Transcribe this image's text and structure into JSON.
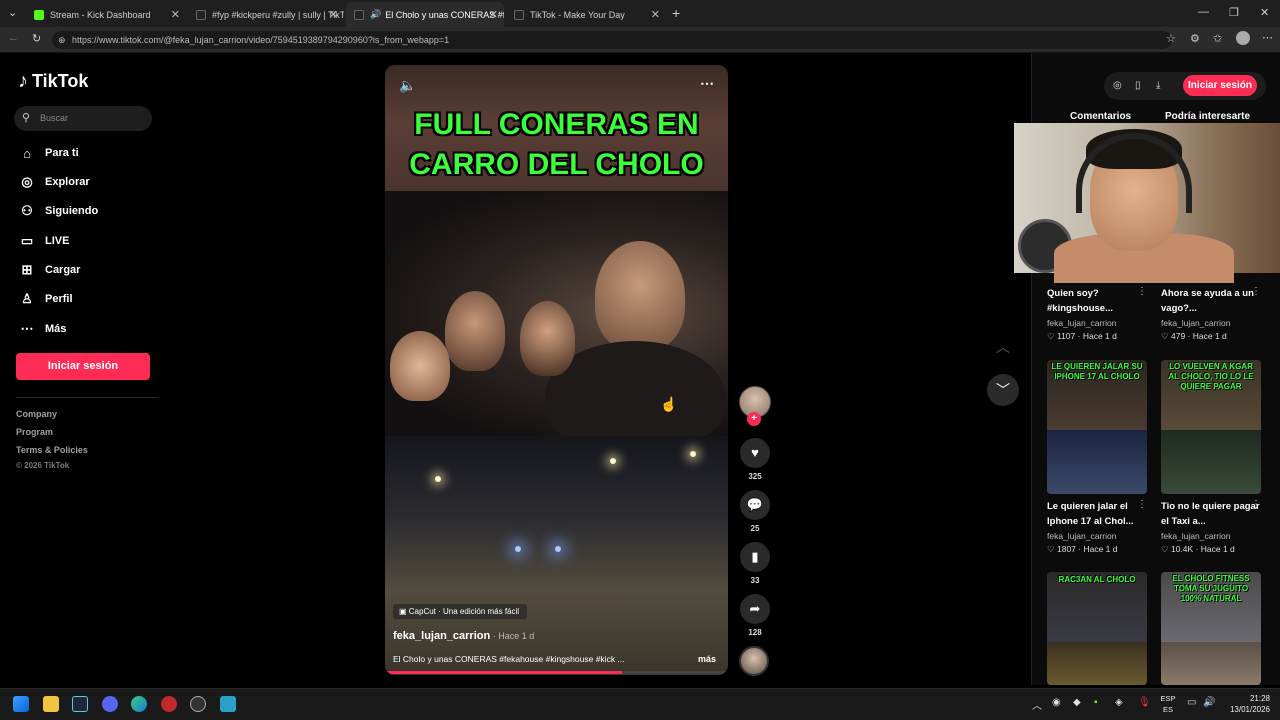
{
  "browser": {
    "tabs": [
      {
        "title": "Stream - Kick Dashboard",
        "color": "#53fc18"
      },
      {
        "title": "#fyp #kickperu #zully | sully | TikTo",
        "color": "#ffffff"
      },
      {
        "title": "El Cholo y unas CONERAS #fe",
        "color": "#ffffff"
      },
      {
        "title": "TikTok - Make Your Day",
        "color": "#ffffff"
      }
    ],
    "url": "https://www.tiktok.com/@feka_lujan_carrion/video/7594519389794290960?is_from_webapp=1"
  },
  "sidebar": {
    "logo": "TikTok",
    "search_placeholder": "Buscar",
    "nav": [
      {
        "label": "Para ti",
        "icon": "home-icon"
      },
      {
        "label": "Explorar",
        "icon": "compass-icon"
      },
      {
        "label": "Siguiendo",
        "icon": "following-icon"
      },
      {
        "label": "LIVE",
        "icon": "live-icon"
      },
      {
        "label": "Cargar",
        "icon": "upload-icon"
      },
      {
        "label": "Perfil",
        "icon": "profile-icon"
      },
      {
        "label": "Más",
        "icon": "more-icon"
      }
    ],
    "login_label": "Iniciar sesión",
    "footer": [
      "Company",
      "Program",
      "Terms & Policies"
    ],
    "copyright": "© 2026 TikTok"
  },
  "video": {
    "title_line1": "FULL CONERAS EN",
    "title_line2": "CARRO DEL CHOLO",
    "capcut": "CapCut · Una edición más fácil",
    "author": "feka_lujan_carrion",
    "time": " · Hace 1 d",
    "caption": "El Cholo y unas CONERAS #fekahouse #kingshouse #kick ...",
    "more": "más",
    "progress": 0.69
  },
  "actions": {
    "likes": "325",
    "comments": "25",
    "saves": "33",
    "shares": "128"
  },
  "right_panel": {
    "login_label": "Iniciar sesión",
    "tabs": [
      "Comentarios",
      "Podría interesarte"
    ],
    "cards": [
      {
        "title": "Quien soy? #kingshouse...",
        "author": "feka_lujan_carrion",
        "likes": "1107",
        "time": "Hace 1 d"
      },
      {
        "title": "Ahora se ayuda a un vago?...",
        "author": "feka_lujan_carrion",
        "likes": "479",
        "time": "Hace 1 d"
      },
      {
        "title": "Le quieren jalar el Iphone 17 al Chol...",
        "author": "feka_lujan_carrion",
        "likes": "1807",
        "time": "Hace 1 d",
        "thumb_text": "LE QUIEREN JALAR SU IPHONE 17 AL CHOLO"
      },
      {
        "title": "Tio no le quiere pagar el Taxi a...",
        "author": "feka_lujan_carrion",
        "likes": "10.4K",
        "time": "Hace 1 d",
        "thumb_text": "LO VUELVEN A KGAR AL CHOLO, TIO LO LE QUIERE PAGAR"
      },
      {
        "thumb_text": "RAC3AN AL CHOLO"
      },
      {
        "thumb_text": "EL CHOLO FITNESS TOMA SU JUGUITO 100% NATURAL"
      }
    ]
  },
  "taskbar": {
    "lang1": "ESP",
    "lang2": "ES",
    "time": "21:28",
    "date": "13/01/2026"
  },
  "colors": {
    "accent": "#fe2c55",
    "title_green": "#3cff3c"
  }
}
